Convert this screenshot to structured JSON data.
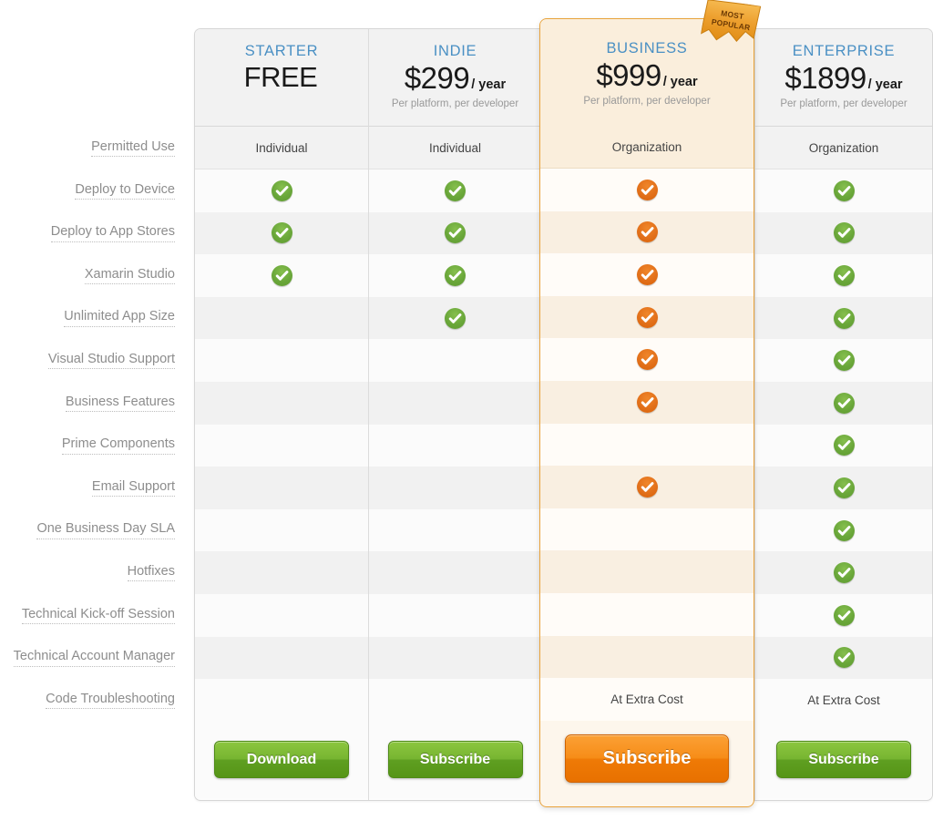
{
  "ribbon": {
    "line1": "MOST",
    "line2": "POPULAR",
    "color": "#eda02f"
  },
  "colors": {
    "plan_name": "#4a90c4",
    "check_green": "#6aa73a",
    "check_orange": "#e2701a",
    "highlight_border": "#e9a33c",
    "button_green": "#77b531",
    "button_orange": "#f78d18"
  },
  "plans": [
    {
      "name": "STARTER",
      "price": "FREE",
      "per": "",
      "note": "",
      "permitted_use": "Individual",
      "cta": "Download",
      "cta_style": "green"
    },
    {
      "name": "INDIE",
      "price": "$299",
      "per": "/ year",
      "note": "Per platform, per developer",
      "permitted_use": "Individual",
      "cta": "Subscribe",
      "cta_style": "green"
    },
    {
      "name": "BUSINESS",
      "price": "$999",
      "per": "/ year",
      "note": "Per platform, per developer",
      "permitted_use": "Organization",
      "cta": "Subscribe",
      "cta_style": "orange"
    },
    {
      "name": "ENTERPRISE",
      "price": "$1899",
      "per": "/ year",
      "note": "Per platform, per developer",
      "permitted_use": "Organization",
      "cta": "Subscribe",
      "cta_style": "green"
    }
  ],
  "features": [
    {
      "label": "Deploy to Device",
      "values": [
        "check",
        "check",
        "check-orange",
        "check"
      ]
    },
    {
      "label": "Deploy to App Stores",
      "values": [
        "check",
        "check",
        "check-orange",
        "check"
      ]
    },
    {
      "label": "Xamarin Studio",
      "values": [
        "check",
        "check",
        "check-orange",
        "check"
      ]
    },
    {
      "label": "Unlimited App Size",
      "values": [
        "",
        "check",
        "check-orange",
        "check"
      ]
    },
    {
      "label": "Visual Studio Support",
      "values": [
        "",
        "",
        "check-orange",
        "check"
      ]
    },
    {
      "label": "Business Features",
      "values": [
        "",
        "",
        "check-orange",
        "check"
      ]
    },
    {
      "label": "Prime Components",
      "values": [
        "",
        "",
        "",
        "check"
      ]
    },
    {
      "label": "Email Support",
      "values": [
        "",
        "",
        "check-orange",
        "check"
      ]
    },
    {
      "label": "One Business Day SLA",
      "values": [
        "",
        "",
        "",
        "check"
      ]
    },
    {
      "label": "Hotfixes",
      "values": [
        "",
        "",
        "",
        "check"
      ]
    },
    {
      "label": "Technical Kick-off Session",
      "values": [
        "",
        "",
        "",
        "check"
      ]
    },
    {
      "label": "Technical Account Manager",
      "values": [
        "",
        "",
        "",
        "check"
      ]
    },
    {
      "label": "Code Troubleshooting",
      "values": [
        "",
        "",
        "At Extra Cost",
        "At Extra Cost"
      ]
    }
  ],
  "permitted_use_label": "Permitted Use"
}
